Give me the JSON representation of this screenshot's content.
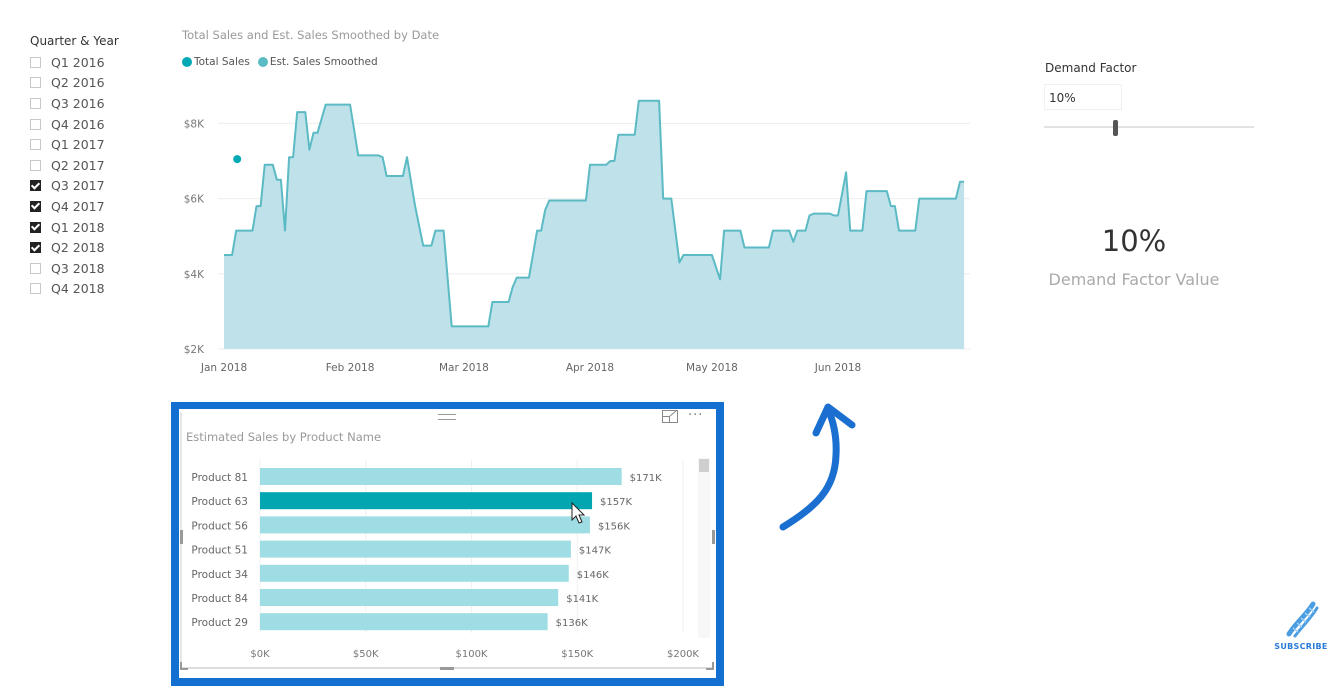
{
  "slicer": {
    "title": "Quarter & Year",
    "items": [
      {
        "label": "Q1 2016",
        "checked": false
      },
      {
        "label": "Q2 2016",
        "checked": false
      },
      {
        "label": "Q3 2016",
        "checked": false
      },
      {
        "label": "Q4 2016",
        "checked": false
      },
      {
        "label": "Q1 2017",
        "checked": false
      },
      {
        "label": "Q2 2017",
        "checked": false
      },
      {
        "label": "Q3 2017",
        "checked": true
      },
      {
        "label": "Q4 2017",
        "checked": true
      },
      {
        "label": "Q1 2018",
        "checked": true
      },
      {
        "label": "Q2 2018",
        "checked": true
      },
      {
        "label": "Q3 2018",
        "checked": false
      },
      {
        "label": "Q4 2018",
        "checked": false
      }
    ]
  },
  "demand_factor": {
    "title": "Demand Factor",
    "input_value": "10%",
    "slider_fraction": 0.34,
    "card_value": "10%",
    "card_label": "Demand Factor Value"
  },
  "colors": {
    "total_sales": "#01a9b4",
    "smoothed_line": "#5bbac4",
    "smoothed_fill": "#bfe2ea",
    "bar": "#9edde3",
    "bar_highlight": "#01a6b0",
    "frame": "#1470d0"
  },
  "bar_panel": {
    "focus_icon": "focus-mode-icon",
    "more_icon_text": "···"
  },
  "subscribe": {
    "label": "SUBSCRIBE",
    "icon": "dna-icon"
  },
  "chart_data": [
    {
      "type": "area",
      "title": "Total Sales and Est. Sales Smoothed by Date",
      "legend": [
        "Total Sales",
        "Est. Sales Smoothed"
      ],
      "legend_position": "top-left",
      "xlabel": "",
      "ylabel": "",
      "x_ticks": [
        "Jan 2018",
        "Feb 2018",
        "Mar 2018",
        "Apr 2018",
        "May 2018",
        "Jun 2018"
      ],
      "x_tick_days": [
        0,
        31,
        59,
        90,
        120,
        151
      ],
      "x_range_days": [
        0,
        180
      ],
      "y_ticks": [
        "$2K",
        "$4K",
        "$6K",
        "$8K"
      ],
      "y_tick_values": [
        2000,
        4000,
        6000,
        8000
      ],
      "ylim": [
        2000,
        8600
      ],
      "grid": true,
      "series": [
        {
          "name": "Total Sales",
          "kind": "point",
          "points": [
            [
              3,
              7050
            ]
          ]
        },
        {
          "name": "Est. Sales Smoothed",
          "kind": "area",
          "points": [
            [
              0,
              4500
            ],
            [
              2,
              4500
            ],
            [
              3,
              5150
            ],
            [
              7,
              5150
            ],
            [
              8,
              5800
            ],
            [
              9,
              5800
            ],
            [
              10,
              6900
            ],
            [
              12,
              6900
            ],
            [
              13,
              6500
            ],
            [
              14,
              6500
            ],
            [
              15,
              5150
            ],
            [
              16,
              7100
            ],
            [
              17,
              7100
            ],
            [
              18,
              8300
            ],
            [
              20,
              8300
            ],
            [
              21,
              7300
            ],
            [
              22,
              7750
            ],
            [
              23,
              7750
            ],
            [
              25,
              8500
            ],
            [
              31,
              8500
            ],
            [
              33,
              7150
            ],
            [
              38,
              7150
            ],
            [
              39,
              7100
            ],
            [
              40,
              6600
            ],
            [
              44,
              6600
            ],
            [
              45,
              7100
            ],
            [
              47,
              5800
            ],
            [
              49,
              4750
            ],
            [
              51,
              4750
            ],
            [
              52,
              5150
            ],
            [
              54,
              5150
            ],
            [
              56,
              2600
            ],
            [
              65,
              2600
            ],
            [
              66,
              3250
            ],
            [
              70,
              3250
            ],
            [
              71,
              3650
            ],
            [
              72,
              3900
            ],
            [
              75,
              3900
            ],
            [
              77,
              5150
            ],
            [
              78,
              5150
            ],
            [
              79,
              5700
            ],
            [
              80,
              5950
            ],
            [
              89,
              5950
            ],
            [
              90,
              6900
            ],
            [
              94,
              6900
            ],
            [
              95,
              7000
            ],
            [
              96,
              7000
            ],
            [
              97,
              7700
            ],
            [
              101,
              7700
            ],
            [
              102,
              8600
            ],
            [
              107,
              8600
            ],
            [
              108,
              6000
            ],
            [
              110,
              6000
            ],
            [
              112,
              4300
            ],
            [
              113,
              4500
            ],
            [
              120,
              4500
            ],
            [
              122,
              3850
            ],
            [
              123,
              5150
            ],
            [
              127,
              5150
            ],
            [
              128,
              4700
            ],
            [
              134,
              4700
            ],
            [
              135,
              5150
            ],
            [
              139,
              5150
            ],
            [
              140,
              4850
            ],
            [
              141,
              5150
            ],
            [
              143,
              5150
            ],
            [
              144,
              5550
            ],
            [
              145,
              5600
            ],
            [
              149,
              5600
            ],
            [
              150,
              5550
            ],
            [
              151,
              5550
            ],
            [
              153,
              6700
            ],
            [
              154,
              5150
            ],
            [
              157,
              5150
            ],
            [
              158,
              6200
            ],
            [
              163,
              6200
            ],
            [
              164,
              5800
            ],
            [
              165,
              5800
            ],
            [
              166,
              5150
            ],
            [
              170,
              5150
            ],
            [
              171,
              6000
            ],
            [
              180,
              6000
            ],
            [
              181,
              6450
            ],
            [
              182,
              6450
            ]
          ]
        }
      ]
    },
    {
      "type": "bar",
      "orientation": "horizontal",
      "title": "Estimated Sales by Product Name",
      "categories": [
        "Product 81",
        "Product 63",
        "Product 56",
        "Product 51",
        "Product 34",
        "Product 84",
        "Product 29"
      ],
      "values": [
        171000,
        157000,
        156000,
        147000,
        146000,
        141000,
        136000
      ],
      "data_labels": [
        "$171K",
        "$157K",
        "$156K",
        "$147K",
        "$146K",
        "$141K",
        "$136K"
      ],
      "highlighted": "Product 63",
      "x_ticks": [
        "$0K",
        "$50K",
        "$100K",
        "$150K",
        "$200K"
      ],
      "x_tick_values": [
        0,
        50000,
        100000,
        150000,
        200000
      ],
      "xlim": [
        0,
        200000
      ],
      "xlabel": "",
      "ylabel": "",
      "grid": true
    }
  ]
}
